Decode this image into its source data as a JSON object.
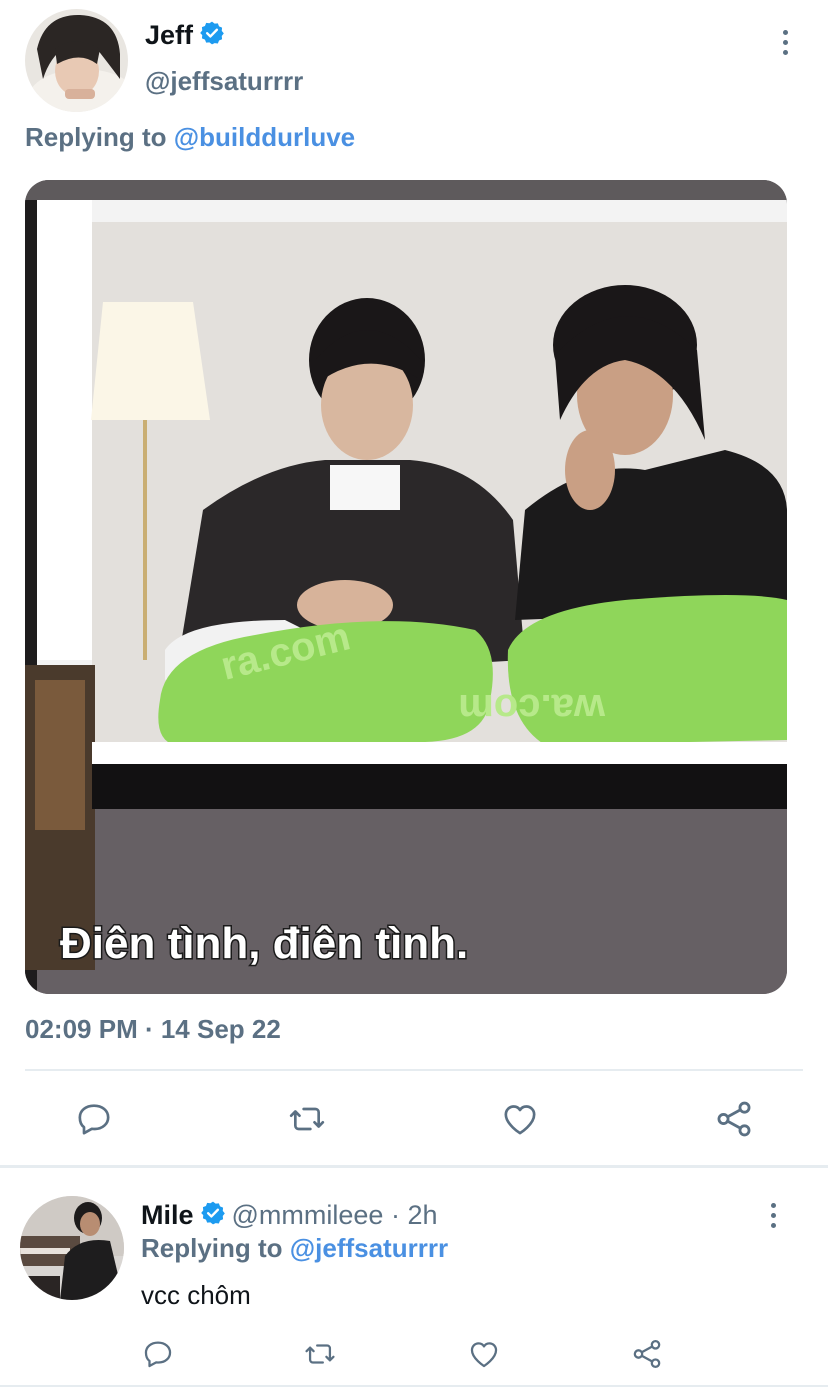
{
  "tweet": {
    "author_name": "Jeff",
    "author_handle": "@jeffsaturrrr",
    "replying_prefix": "Replying to ",
    "replying_to": "@builddurluve",
    "media_caption": "Điên tình, điên tình.",
    "media_watermark_left": "ra.com",
    "media_watermark_right": "wa.com",
    "timestamp": "02:09 PM · 14 Sep 22"
  },
  "reply": {
    "author_name": "Mile",
    "author_handle": "@mmmileee",
    "time_sep": " · ",
    "time": "2h",
    "replying_prefix": "Replying to ",
    "replying_to": "@jeffsaturrrr",
    "text": "vcc chôm"
  },
  "icons": {
    "verified": "verified-badge-icon",
    "more": "more-vertical-icon",
    "reply": "reply-icon",
    "retweet": "retweet-icon",
    "like": "heart-icon",
    "share": "share-icon"
  },
  "colors": {
    "link": "#4a90e2",
    "muted": "#5b7083",
    "verified": "#1d9bf0",
    "divider": "#e6ecf0"
  }
}
